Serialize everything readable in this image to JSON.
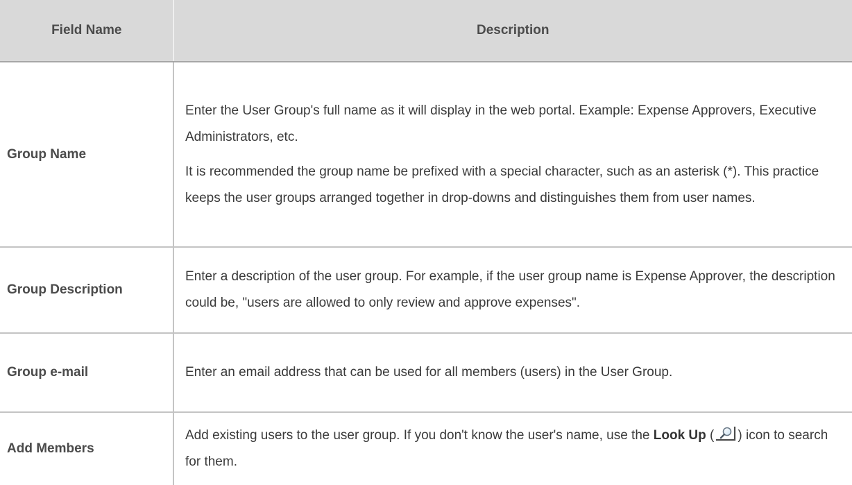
{
  "table": {
    "headers": {
      "field_name": "Field Name",
      "description": "Description"
    },
    "rows": [
      {
        "field": "Group Name",
        "paragraphs": [
          "Enter the User Group's full name as it will display in the web portal. Example: Expense Approvers, Executive Administrators, etc.",
          "It is recommended the group name be prefixed with a special character, such as an asterisk (*). This practice keeps the user groups arranged together in drop-downs and distinguishes them from user names."
        ]
      },
      {
        "field": "Group Description",
        "text": "Enter a description of the user group. For example, if the user group name is Expense Approver, the description could be, \"users are allowed to only review and approve expenses\"."
      },
      {
        "field": "Group e-mail",
        "text": "Enter an email address that can be used for all members (users) in the User Group."
      },
      {
        "field": "Add Members",
        "text_before": "Add existing users to the user group. If you don't know the user's name, use the ",
        "lookup_label": "Look Up",
        "paren_open": " (",
        "icon": "magnifier-icon",
        "text_after": ") icon to search for them."
      }
    ]
  }
}
